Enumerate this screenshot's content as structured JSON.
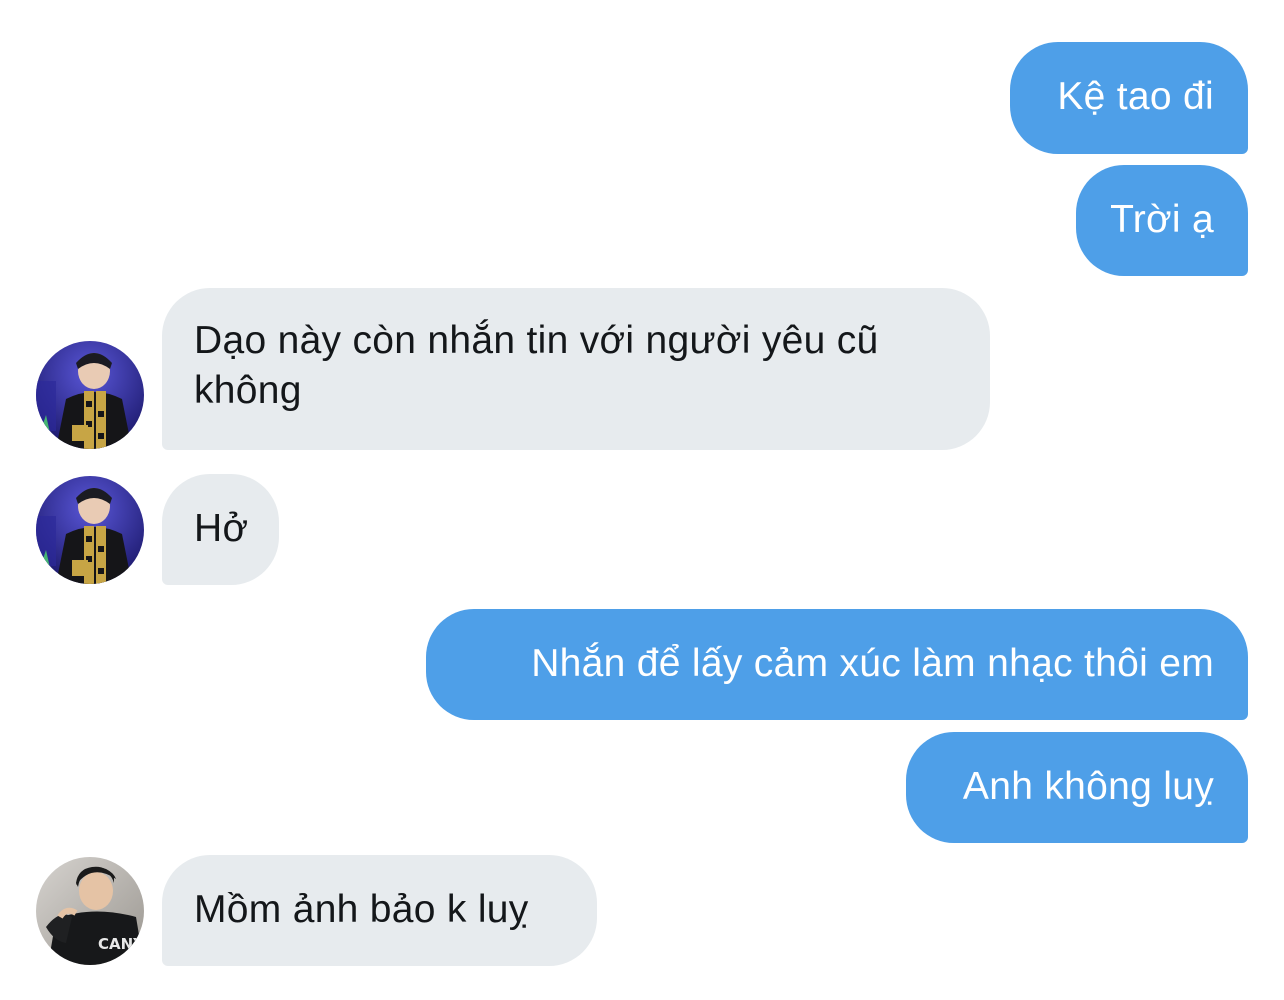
{
  "conversation": {
    "messages": [
      {
        "direction": "outgoing",
        "text": "Kệ tao đi"
      },
      {
        "direction": "outgoing",
        "text": "Trời ạ"
      },
      {
        "direction": "incoming",
        "sender_avatar": "avatar-photo-a",
        "text": "Dạo này còn nhắn tin với người yêu cũ không"
      },
      {
        "direction": "incoming",
        "sender_avatar": "avatar-photo-a",
        "text": "Hở"
      },
      {
        "direction": "outgoing",
        "text": "Nhắn để lấy cảm xúc làm nhạc thôi em"
      },
      {
        "direction": "outgoing",
        "text": "Anh không luỵ"
      },
      {
        "direction": "incoming",
        "sender_avatar": "avatar-photo-b",
        "text": "Mồm ảnh bảo k luỵ"
      }
    ],
    "avatar_b_jersey_text": "CANY"
  },
  "colors": {
    "outgoing_bubble": "#4e9fe8",
    "incoming_bubble": "#e7ebee",
    "incoming_text": "#14171a",
    "outgoing_text": "#ffffff",
    "background": "#ffffff"
  }
}
